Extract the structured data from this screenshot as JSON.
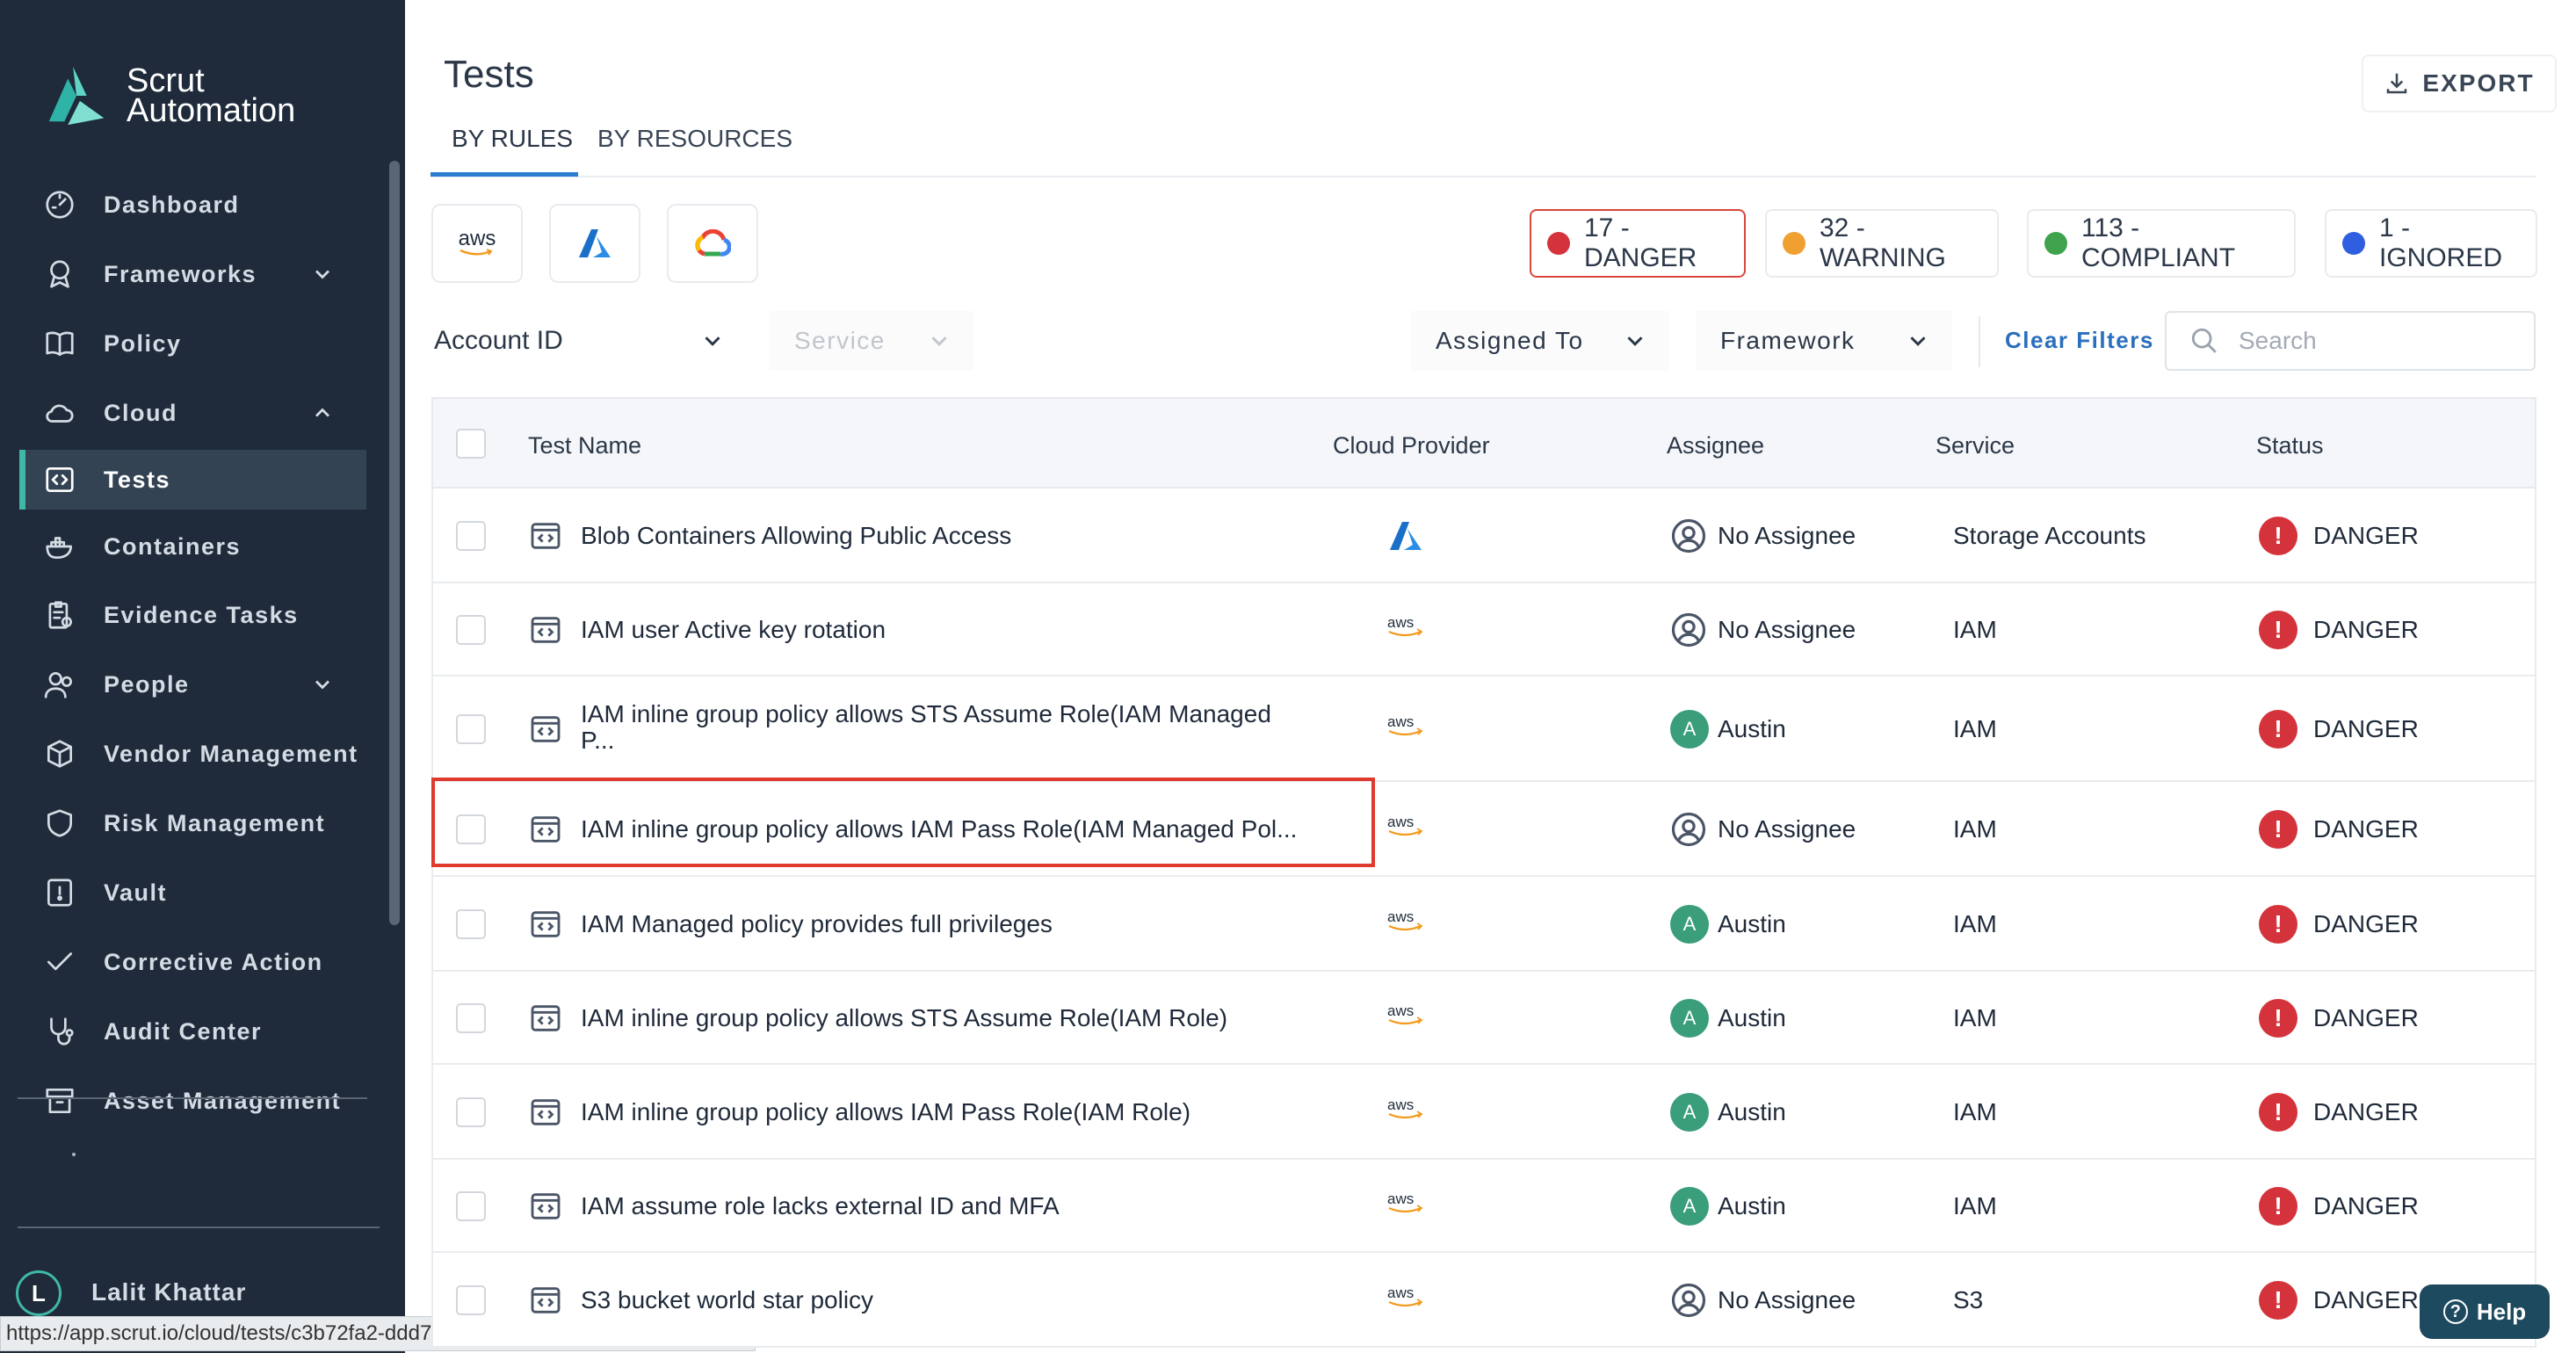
{
  "app": {
    "logo_line1": "Scrut",
    "logo_line2": "Automation"
  },
  "sidebar": {
    "items": [
      {
        "label": "Dashboard",
        "icon": "dashboard-icon"
      },
      {
        "label": "Frameworks",
        "icon": "award-icon",
        "chevron": "down"
      },
      {
        "label": "Policy",
        "icon": "book-icon"
      },
      {
        "label": "Cloud",
        "icon": "cloud-icon",
        "chevron": "up"
      },
      {
        "label": "Tests",
        "icon": "code-icon",
        "active": true
      },
      {
        "label": "Containers",
        "icon": "docker-icon"
      },
      {
        "label": "Evidence Tasks",
        "icon": "clipboard-icon"
      },
      {
        "label": "People",
        "icon": "people-icon",
        "chevron": "down"
      },
      {
        "label": "Vendor Management",
        "icon": "box-icon"
      },
      {
        "label": "Risk Management",
        "icon": "shield-icon"
      },
      {
        "label": "Vault",
        "icon": "vault-icon"
      },
      {
        "label": "Corrective Action",
        "icon": "check-icon"
      },
      {
        "label": "Audit Center",
        "icon": "stethoscope-icon"
      },
      {
        "label": "Asset Management",
        "icon": "archive-icon"
      }
    ],
    "user": {
      "initial": "L",
      "name": "Lalit Khattar"
    }
  },
  "status_url": "https://app.scrut.io/cloud/tests/c3b72fa2-ddd7-47a4-b72e-87147605b1f6",
  "header": {
    "title": "Tests",
    "export_label": "EXPORT"
  },
  "tabs": [
    {
      "label": "BY RULES",
      "active": true
    },
    {
      "label": "BY RESOURCES"
    }
  ],
  "providers": [
    "aws",
    "azure",
    "gcp"
  ],
  "status_cards": [
    {
      "label": "17 - DANGER",
      "color": "#d4333b",
      "selected": true
    },
    {
      "label": "32 - WARNING",
      "color": "#f0a030"
    },
    {
      "label": "113 - COMPLIANT",
      "color": "#3fa34d"
    },
    {
      "label": "1 - IGNORED",
      "color": "#2f5fe0"
    }
  ],
  "filters": {
    "account_id": "Account ID",
    "service": "Service",
    "assigned_to": "Assigned To",
    "framework": "Framework",
    "clear": "Clear Filters",
    "search_placeholder": "Search"
  },
  "table": {
    "columns": [
      "Test Name",
      "Cloud Provider",
      "Assignee",
      "Service",
      "Status"
    ],
    "rows": [
      {
        "name": "Blob Containers Allowing Public Access",
        "provider": "azure",
        "assignee": "No Assignee",
        "service": "Storage Accounts",
        "status": "DANGER"
      },
      {
        "name": "IAM user Active key rotation",
        "provider": "aws",
        "assignee": "No Assignee",
        "service": "IAM",
        "status": "DANGER"
      },
      {
        "name": "IAM inline group policy allows STS Assume Role(IAM Managed",
        "name2": "P...",
        "provider": "aws",
        "assignee": "Austin",
        "service": "IAM",
        "status": "DANGER"
      },
      {
        "name": "IAM inline group policy allows IAM Pass Role(IAM Managed Pol...",
        "provider": "aws",
        "assignee": "No Assignee",
        "service": "IAM",
        "status": "DANGER"
      },
      {
        "name": "IAM Managed policy provides full privileges",
        "provider": "aws",
        "assignee": "Austin",
        "service": "IAM",
        "status": "DANGER"
      },
      {
        "name": "IAM inline group policy allows STS Assume Role(IAM Role)",
        "provider": "aws",
        "assignee": "Austin",
        "service": "IAM",
        "status": "DANGER"
      },
      {
        "name": "IAM inline group policy allows IAM Pass Role(IAM Role)",
        "provider": "aws",
        "assignee": "Austin",
        "service": "IAM",
        "status": "DANGER"
      },
      {
        "name": "IAM assume role lacks external ID and MFA",
        "provider": "aws",
        "assignee": "Austin",
        "service": "IAM",
        "status": "DANGER"
      },
      {
        "name": "S3 bucket world star policy",
        "provider": "aws",
        "assignee": "No Assignee",
        "service": "S3",
        "status": "DANGER"
      }
    ]
  },
  "help_label": "Help",
  "provider_aws_text": "aws",
  "assignee_avatar_initial": "A"
}
